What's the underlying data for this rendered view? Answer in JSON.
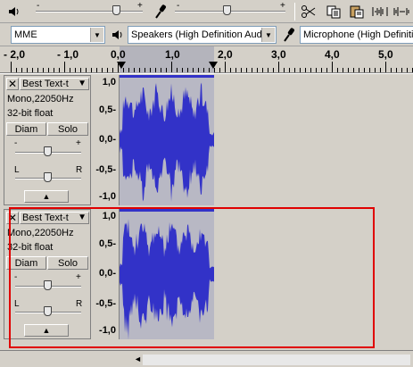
{
  "toolbar": {
    "volume_minus": "-",
    "volume_plus": "+",
    "mic_minus": "-",
    "mic_plus": "+"
  },
  "devices": {
    "host": "MME",
    "output": "Speakers (High Definition Audio",
    "input": "Microphone (High Definition"
  },
  "ruler": {
    "labels": [
      "- 2,0",
      "- 1,0",
      "0,0",
      "1,0",
      "2,0",
      "3,0",
      "4,0",
      "5,0"
    ]
  },
  "tracks": [
    {
      "name": "Best Text-t",
      "format": "Mono,22050Hz",
      "bits": "32-bit float",
      "mute": "Diam",
      "solo": "Solo",
      "gain_minus": "-",
      "gain_plus": "+",
      "pan_left": "L",
      "pan_right": "R",
      "scale": [
        "1,0",
        "0,5-",
        "0,0-",
        "-0,5-",
        "-1,0"
      ]
    },
    {
      "name": "Best Text-t",
      "format": "Mono,22050Hz",
      "bits": "32-bit float",
      "mute": "Diam",
      "solo": "Solo",
      "gain_minus": "-",
      "gain_plus": "+",
      "pan_left": "L",
      "pan_right": "R",
      "scale": [
        "1,0",
        "0,5-",
        "0,0-",
        "-0,5-",
        "-1,0"
      ]
    }
  ],
  "colors": {
    "highlight_box": "#e00000",
    "waveform": "#3232c8",
    "background": "#d4d0c8"
  }
}
